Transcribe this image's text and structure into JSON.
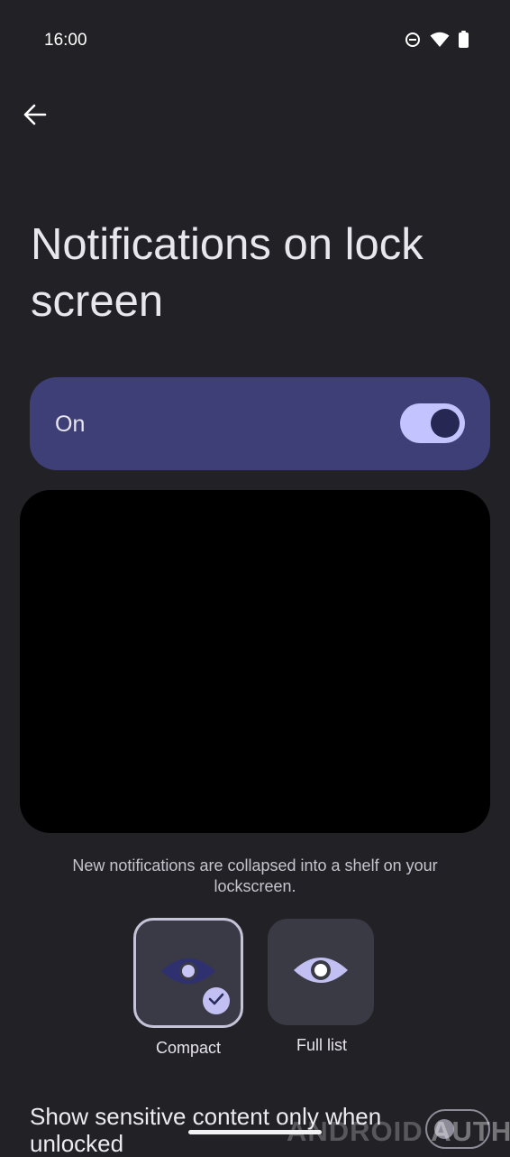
{
  "status_bar": {
    "time": "16:00",
    "icons": [
      "do-not-disturb-icon",
      "wifi-icon",
      "battery-icon"
    ]
  },
  "header": {
    "back_icon": "arrow-left-icon"
  },
  "page": {
    "title": "Notifications on lock screen"
  },
  "main_switch": {
    "label": "On",
    "checked": true
  },
  "preview": {
    "description": "New notifications are collapsed into a shelf on your lockscreen."
  },
  "layout_options": {
    "selected": "Compact",
    "items": [
      {
        "label": "Compact",
        "icon": "eye-icon",
        "selected": true
      },
      {
        "label": "Full list",
        "icon": "eye-icon",
        "selected": false
      }
    ]
  },
  "sensitive_setting": {
    "label": "Show sensitive content only when unlocked",
    "checked": false
  },
  "watermark": {
    "part1": "ANDROID",
    "part2": "AUTHORITY"
  },
  "colors": {
    "background": "#212126",
    "switch_container": "#3e3f76",
    "toggle_track": "#c3c3ff",
    "toggle_thumb": "#262853",
    "preview": "#000000",
    "option_tile": "#3a3a44",
    "accent": "#c2c0f3"
  }
}
